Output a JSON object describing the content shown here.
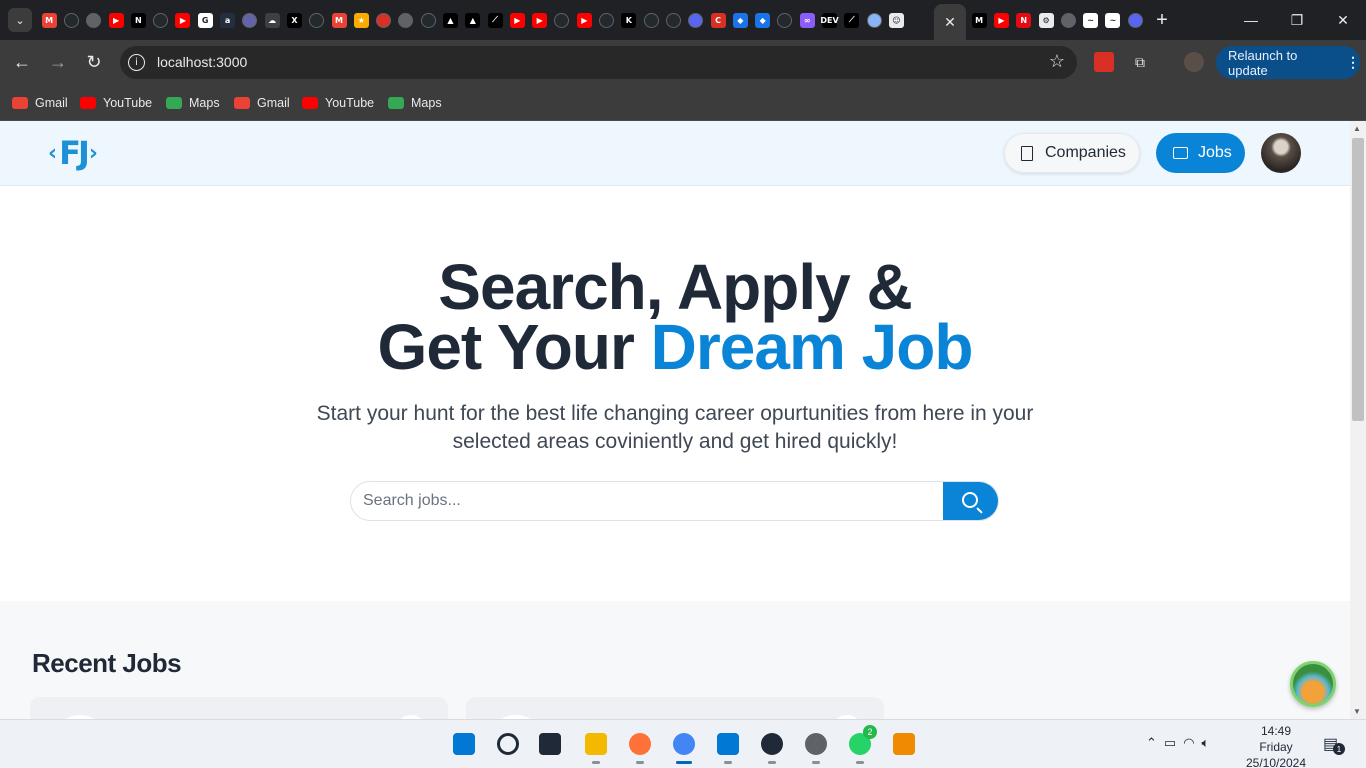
{
  "browser": {
    "tab_favicons": [
      {
        "name": "gmail-icon",
        "color": "#ea4335",
        "glyph": "M"
      },
      {
        "name": "github-icon",
        "color": "#24292e",
        "glyph": ""
      },
      {
        "name": "globe-icon",
        "color": "#5f6368",
        "glyph": ""
      },
      {
        "name": "youtube-icon",
        "color": "#ff0000",
        "glyph": "▶"
      },
      {
        "name": "nextjs-icon",
        "color": "#000000",
        "glyph": "N"
      },
      {
        "name": "github-icon",
        "color": "#24292e",
        "glyph": ""
      },
      {
        "name": "youtube-icon",
        "color": "#ff0000",
        "glyph": "▶"
      },
      {
        "name": "google-icon",
        "color": "#ffffff",
        "glyph": "G"
      },
      {
        "name": "amazon-icon",
        "color": "#232f3e",
        "glyph": "a"
      },
      {
        "name": "teams-icon",
        "color": "#6264a7",
        "glyph": ""
      },
      {
        "name": "cloud-icon",
        "color": "#3c4043",
        "glyph": "☁"
      },
      {
        "name": "x-icon",
        "color": "#000000",
        "glyph": "X"
      },
      {
        "name": "github-icon",
        "color": "#24292e",
        "glyph": ""
      },
      {
        "name": "gmail-icon",
        "color": "#ea4335",
        "glyph": "M"
      },
      {
        "name": "star-icon",
        "color": "#f9ab00",
        "glyph": "★"
      },
      {
        "name": "puzzle-icon",
        "color": "#d93025",
        "glyph": ""
      },
      {
        "name": "globe-icon",
        "color": "#5f6368",
        "glyph": ""
      },
      {
        "name": "github-icon",
        "color": "#24292e",
        "glyph": ""
      },
      {
        "name": "vercel-icon",
        "color": "#000000",
        "glyph": "▲"
      },
      {
        "name": "vercel-icon",
        "color": "#000000",
        "glyph": "▲"
      },
      {
        "name": "linear-icon",
        "color": "#000000",
        "glyph": "⟋"
      },
      {
        "name": "youtube-icon",
        "color": "#ff0000",
        "glyph": "▶"
      },
      {
        "name": "youtube-icon",
        "color": "#ff0000",
        "glyph": "▶"
      },
      {
        "name": "github-icon",
        "color": "#24292e",
        "glyph": ""
      },
      {
        "name": "youtube-icon",
        "color": "#ff0000",
        "glyph": "▶"
      },
      {
        "name": "github-icon",
        "color": "#24292e",
        "glyph": ""
      },
      {
        "name": "kaggle-icon",
        "color": "#000000",
        "glyph": "K"
      },
      {
        "name": "github-icon",
        "color": "#24292e",
        "glyph": ""
      },
      {
        "name": "github-icon",
        "color": "#24292e",
        "glyph": ""
      },
      {
        "name": "discord-icon",
        "color": "#5865f2",
        "glyph": ""
      },
      {
        "name": "refresh-icon",
        "color": "#d93025",
        "glyph": "C"
      },
      {
        "name": "diamond-icon",
        "color": "#1a73e8",
        "glyph": "◆"
      },
      {
        "name": "diamond-icon",
        "color": "#1a73e8",
        "glyph": "◆"
      },
      {
        "name": "github-icon",
        "color": "#24292e",
        "glyph": ""
      },
      {
        "name": "infinity-icon",
        "color": "#8b5cf6",
        "glyph": "∞"
      },
      {
        "name": "dev-icon",
        "color": "#000000",
        "glyph": "DEV"
      },
      {
        "name": "linear-icon",
        "color": "#000000",
        "glyph": "⟋"
      },
      {
        "name": "window-icon",
        "color": "#8ab4f8",
        "glyph": ""
      },
      {
        "name": "face-icon",
        "color": "#e8eaed",
        "glyph": "☺"
      }
    ],
    "tab_favicons_right": [
      {
        "name": "medium-icon",
        "color": "#000000",
        "glyph": "M"
      },
      {
        "name": "youtube-icon",
        "color": "#ff0000",
        "glyph": "▶"
      },
      {
        "name": "notion-icon",
        "color": "#e50914",
        "glyph": "N"
      },
      {
        "name": "openai-icon",
        "color": "#e8eaed",
        "glyph": "⚙"
      },
      {
        "name": "globe-icon",
        "color": "#5f6368",
        "glyph": ""
      },
      {
        "name": "wave-icon",
        "color": "#ffffff",
        "glyph": "~"
      },
      {
        "name": "wave-icon",
        "color": "#ffffff",
        "glyph": "~"
      },
      {
        "name": "discord-icon",
        "color": "#5865f2",
        "glyph": ""
      }
    ],
    "active_tab_close": "✕",
    "new_tab": "+",
    "url": "localhost:3000",
    "relaunch_label": "Relaunch to update",
    "bookmarks": [
      {
        "label": "Gmail",
        "icon": "gmail-icon",
        "color": "#ea4335"
      },
      {
        "label": "YouTube",
        "icon": "youtube-icon",
        "color": "#ff0000"
      },
      {
        "label": "Maps",
        "icon": "maps-icon",
        "color": "#34a853"
      },
      {
        "label": "Gmail",
        "icon": "gmail-icon",
        "color": "#ea4335"
      },
      {
        "label": "YouTube",
        "icon": "youtube-icon",
        "color": "#ff0000"
      },
      {
        "label": "Maps",
        "icon": "maps-icon",
        "color": "#34a853"
      }
    ]
  },
  "site": {
    "logo_text": "FJ",
    "nav": {
      "companies_label": "Companies",
      "jobs_label": "Jobs"
    },
    "hero": {
      "line1": "Search, Apply &",
      "line2_plain": "Get Your ",
      "line2_accent": "Dream Job",
      "subtitle": "Start your hunt for the best life changing career opurtunities from here in your selected areas coviniently and get hired quickly!"
    },
    "search": {
      "placeholder": "Search jobs...",
      "value": ""
    },
    "recent_jobs_title": "Recent Jobs",
    "colors": {
      "accent": "#0a84d6",
      "heading": "#1f2937"
    }
  },
  "taskbar": {
    "apps": [
      {
        "name": "windows-start-icon"
      },
      {
        "name": "search-icon"
      },
      {
        "name": "task-view-icon"
      },
      {
        "name": "file-explorer-icon"
      },
      {
        "name": "firefox-icon"
      },
      {
        "name": "chrome-icon"
      },
      {
        "name": "vscode-icon"
      },
      {
        "name": "media-player-icon"
      },
      {
        "name": "settings-icon"
      },
      {
        "name": "whatsapp-icon",
        "badge": "2"
      },
      {
        "name": "vlc-icon"
      }
    ],
    "clock": {
      "time": "14:49",
      "day": "Friday",
      "date": "25/10/2024"
    },
    "notification_count": "1"
  }
}
